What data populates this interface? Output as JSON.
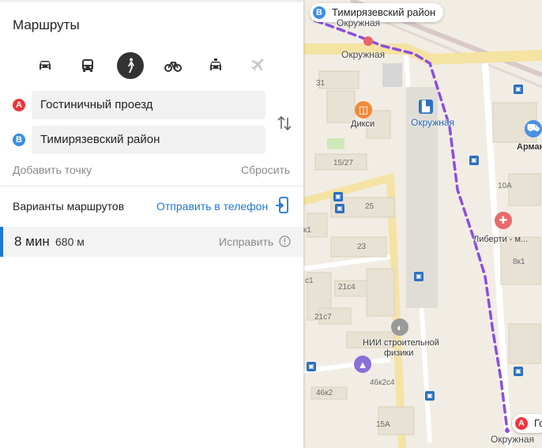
{
  "panel": {
    "title": "Маршруты",
    "transport_modes": [
      {
        "name": "car",
        "icon": "car-icon",
        "active": false
      },
      {
        "name": "bus",
        "icon": "bus-icon",
        "active": false
      },
      {
        "name": "walk",
        "icon": "pedestrian-icon",
        "active": true
      },
      {
        "name": "bike",
        "icon": "bicycle-icon",
        "active": false
      },
      {
        "name": "taxi",
        "icon": "taxi-icon",
        "active": false
      },
      {
        "name": "plane",
        "icon": "plane-icon",
        "active": false
      }
    ],
    "point_a": {
      "label": "A",
      "value": "Гостиничный проезд",
      "color": "#f0343c"
    },
    "point_b": {
      "label": "B",
      "value": "Тимирязевский район",
      "color": "#3a8ee6"
    },
    "add_point": "Добавить точку",
    "reset": "Сбросить",
    "variants_label": "Варианты маршрутов",
    "send_to_phone": "Отправить в телефон",
    "route": {
      "time": "8 мин",
      "distance": "680 м",
      "fix_label": "Исправить"
    }
  },
  "map": {
    "chip_b": {
      "label": "B",
      "text": "Тимирязевский район"
    },
    "chip_a": {
      "label": "A",
      "text": "Го"
    },
    "labels": {
      "okruzhnaya_top": "Окружная",
      "okruzhnaya_road": "Окружная",
      "okruzhnaya_station": "Окружная",
      "okruzhnaya_bottom": "Окружная",
      "diksi": "Дикси",
      "arman": "Арман",
      "liberti": "Либерти - м...",
      "nii1": "НИИ строительной",
      "nii2": "физики"
    },
    "buildings": [
      "31",
      "15/27",
      "10А",
      "25",
      "к1",
      "23",
      "8к1",
      "с1",
      "21с4",
      "21с7",
      "46к2с4",
      "46к2",
      "15А"
    ],
    "route_color": "#8a4fe0",
    "accent": "#1f77d9"
  }
}
